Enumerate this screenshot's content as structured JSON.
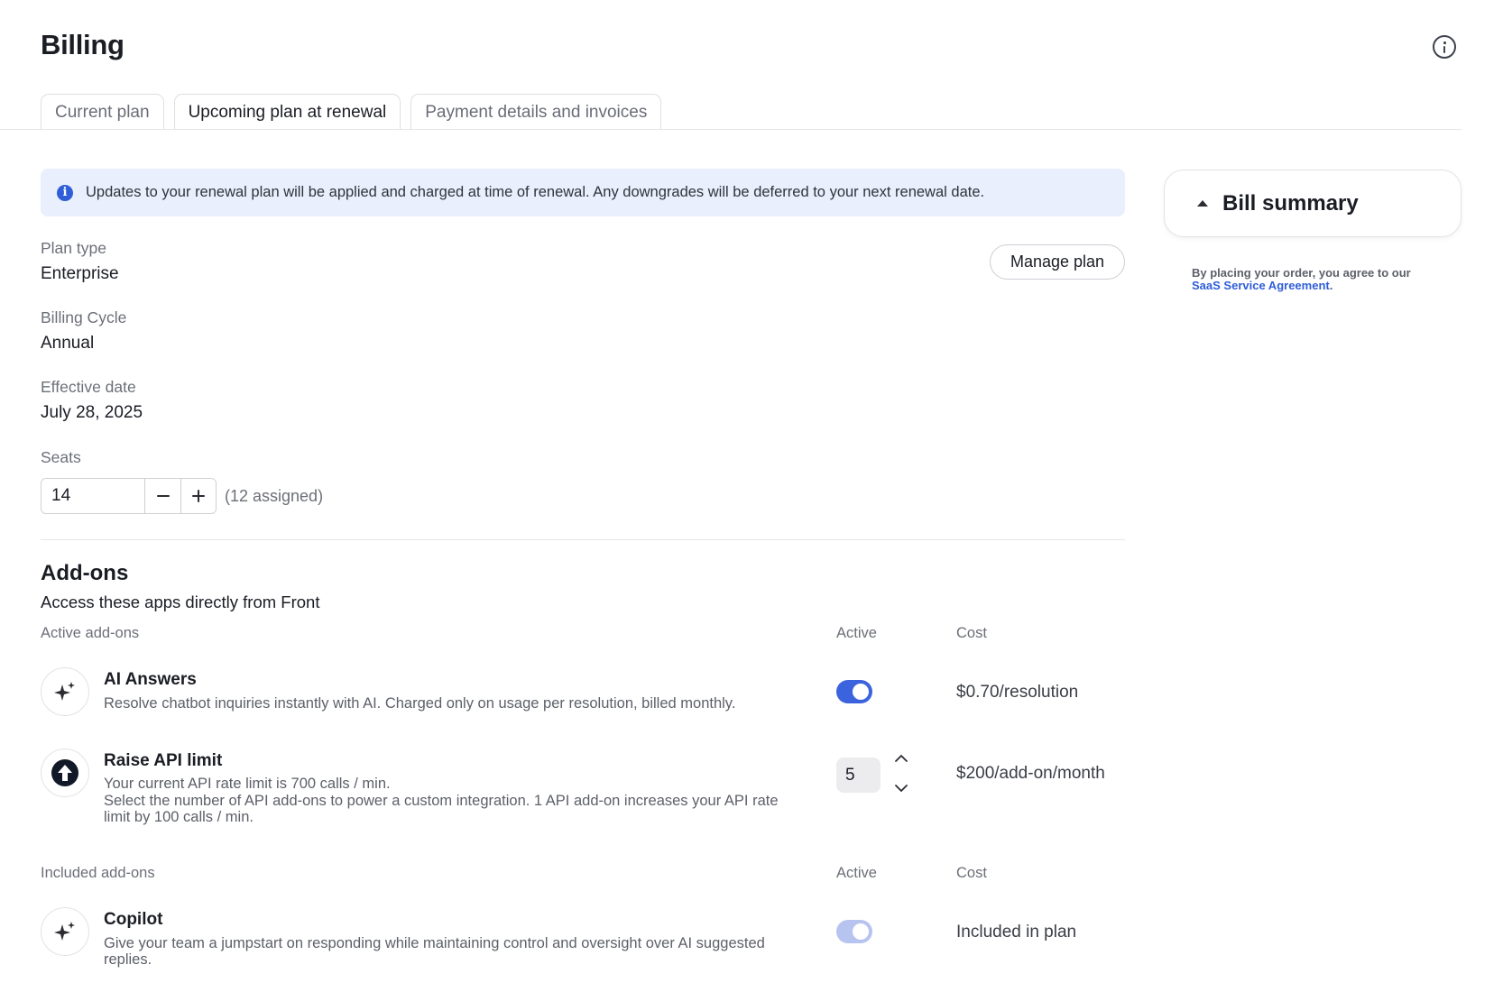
{
  "header": {
    "title": "Billing",
    "info_icon": "info-circle-icon"
  },
  "tabs": [
    {
      "label": "Current plan",
      "active": false
    },
    {
      "label": "Upcoming plan at renewal",
      "active": true
    },
    {
      "label": "Payment details and invoices",
      "active": false
    }
  ],
  "banner": {
    "icon": "info-filled-icon",
    "text": "Updates to your renewal plan will be applied and charged at time of renewal. Any downgrades will be deferred to your next renewal date."
  },
  "plan": {
    "plan_type_label": "Plan type",
    "plan_type_value": "Enterprise",
    "billing_cycle_label": "Billing Cycle",
    "billing_cycle_value": "Annual",
    "effective_date_label": "Effective date",
    "effective_date_value": "July 28, 2025",
    "manage_label": "Manage plan"
  },
  "seats": {
    "label": "Seats",
    "value": "14",
    "assigned": "(12 assigned)"
  },
  "addons": {
    "title": "Add-ons",
    "subtitle": "Access these apps directly from Front",
    "active_heading": "Active add-ons",
    "included_heading": "Included add-ons",
    "col_active": "Active",
    "col_cost": "Cost",
    "active_items": [
      {
        "name": "AI Answers",
        "icon": "sparkle-icon",
        "description": "Resolve chatbot inquiries instantly with AI. Charged only on usage per resolution, billed monthly.",
        "enabled": true,
        "cost": "$0.70/resolution"
      },
      {
        "name": "Raise API limit",
        "icon": "arrow-up-circle-icon",
        "description_line1": "Your current API rate limit is 700 calls / min.",
        "description_line2": "Select the number of API add-ons to power a custom integration. 1 API add-on increases your API rate limit by 100 calls / min.",
        "quantity": "5",
        "cost": "$200/add-on/month"
      }
    ],
    "included_items": [
      {
        "name": "Copilot",
        "icon": "sparkle-icon",
        "description": "Give your team a jumpstart on responding while maintaining control and oversight over AI suggested replies.",
        "enabled": true,
        "cost": "Included in plan"
      }
    ]
  },
  "bill_summary": {
    "title": "Bill summary",
    "agreement_text": "By placing your order, you agree to our",
    "agreement_link": "SaaS Service Agreement",
    "agreement_end": "."
  },
  "colors": {
    "accent": "#3b63dd",
    "banner_bg": "#e9effc",
    "toggle_disabled": "#b7c4f0"
  }
}
